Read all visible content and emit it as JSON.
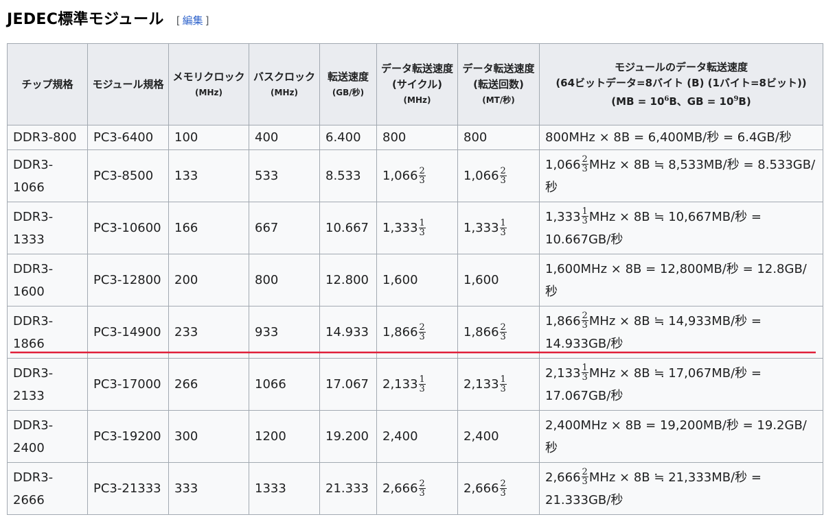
{
  "heading": {
    "title": "JEDEC標準モジュール",
    "edit_open": "[",
    "edit_label": "編集",
    "edit_close": "]"
  },
  "table": {
    "headers": {
      "chip": "チップ規格",
      "module": "モジュール規格",
      "memclock": "メモリクロック",
      "memclock_unit": "(MHz)",
      "busclock": "バスクロック",
      "busclock_unit": "(MHz)",
      "rate": "転送速度",
      "rate_unit": "(GB/秒)",
      "cycle": "データ転送速度",
      "cycle_sub": "(サイクル)",
      "cycle_unit": "(MHz)",
      "transfers": "データ転送速度",
      "transfers_sub": "(転送回数)",
      "transfers_unit": "(MT/秒)",
      "module_rate": "モジュールのデータ転送速度",
      "module_rate_note": "(64ビットデータ=8バイト (B) (1バイト=8ビット))",
      "module_rate_units_mb": "(MB = 10",
      "module_rate_units_mb_exp": "6",
      "module_rate_units_gb": "B、GB = 10",
      "module_rate_units_gb_exp": "9",
      "module_rate_units_end": "B)"
    },
    "rows": [
      {
        "chip": "DDR3-800",
        "module": "PC3-6400",
        "memclock": "100",
        "busclock": "400",
        "rate": "6.400",
        "whole": "800",
        "num": "",
        "den": "",
        "op": "=",
        "mb": "6,400MB/秒",
        "gb_sep": " = ",
        "gb": "6.4GB/秒"
      },
      {
        "chip": "DDR3-1066",
        "module": "PC3-8500",
        "memclock": "133",
        "busclock": "533",
        "rate": "8.533",
        "whole": "1,066",
        "num": "2",
        "den": "3",
        "op": "≒",
        "mb": "8,533MB/秒",
        "gb_sep": " =",
        "gb": "8.533GB/秒"
      },
      {
        "chip": "DDR3-1333",
        "module": "PC3-10600",
        "memclock": "166",
        "busclock": "667",
        "rate": "10.667",
        "whole": "1,333",
        "num": "1",
        "den": "3",
        "op": "≒",
        "mb": "10,667MB/秒",
        "gb_sep": " =",
        "gb": "10.667GB/秒"
      },
      {
        "chip": "DDR3-1600",
        "module": "PC3-12800",
        "memclock": "200",
        "busclock": "800",
        "rate": "12.800",
        "whole": "1,600",
        "num": "",
        "den": "",
        "op": "=",
        "mb": "12,800MB/秒",
        "gb_sep": " =",
        "gb": "12.8GB/秒"
      },
      {
        "chip": "DDR3-1866",
        "module": "PC3-14900",
        "memclock": "233",
        "busclock": "933",
        "rate": "14.933",
        "whole": "1,866",
        "num": "2",
        "den": "3",
        "op": "≒",
        "mb": "14,933MB/秒",
        "gb_sep": " =",
        "gb": "14.933GB/秒"
      },
      {
        "chip": "DDR3-2133",
        "module": "PC3-17000",
        "memclock": "266",
        "busclock": "1066",
        "rate": "17.067",
        "whole": "2,133",
        "num": "1",
        "den": "3",
        "op": "≒",
        "mb": "17,067MB/秒",
        "gb_sep": " =",
        "gb": "17.067GB/秒"
      },
      {
        "chip": "DDR3-2400",
        "module": "PC3-19200",
        "memclock": "300",
        "busclock": "1200",
        "rate": "19.200",
        "whole": "2,400",
        "num": "",
        "den": "",
        "op": "=",
        "mb": "19,200MB/秒",
        "gb_sep": " =",
        "gb": "19.2GB/秒"
      },
      {
        "chip": "DDR3-2666",
        "module": "PC3-21333",
        "memclock": "333",
        "busclock": "1333",
        "rate": "21.333",
        "whole": "2,666",
        "num": "2",
        "den": "3",
        "op": "≒",
        "mb": "21,333MB/秒",
        "gb_sep": " =",
        "gb": "21.333GB/秒"
      }
    ],
    "formula_unit": "MHz × 8B"
  },
  "annotation": {
    "underline_color": "#e0203a"
  }
}
